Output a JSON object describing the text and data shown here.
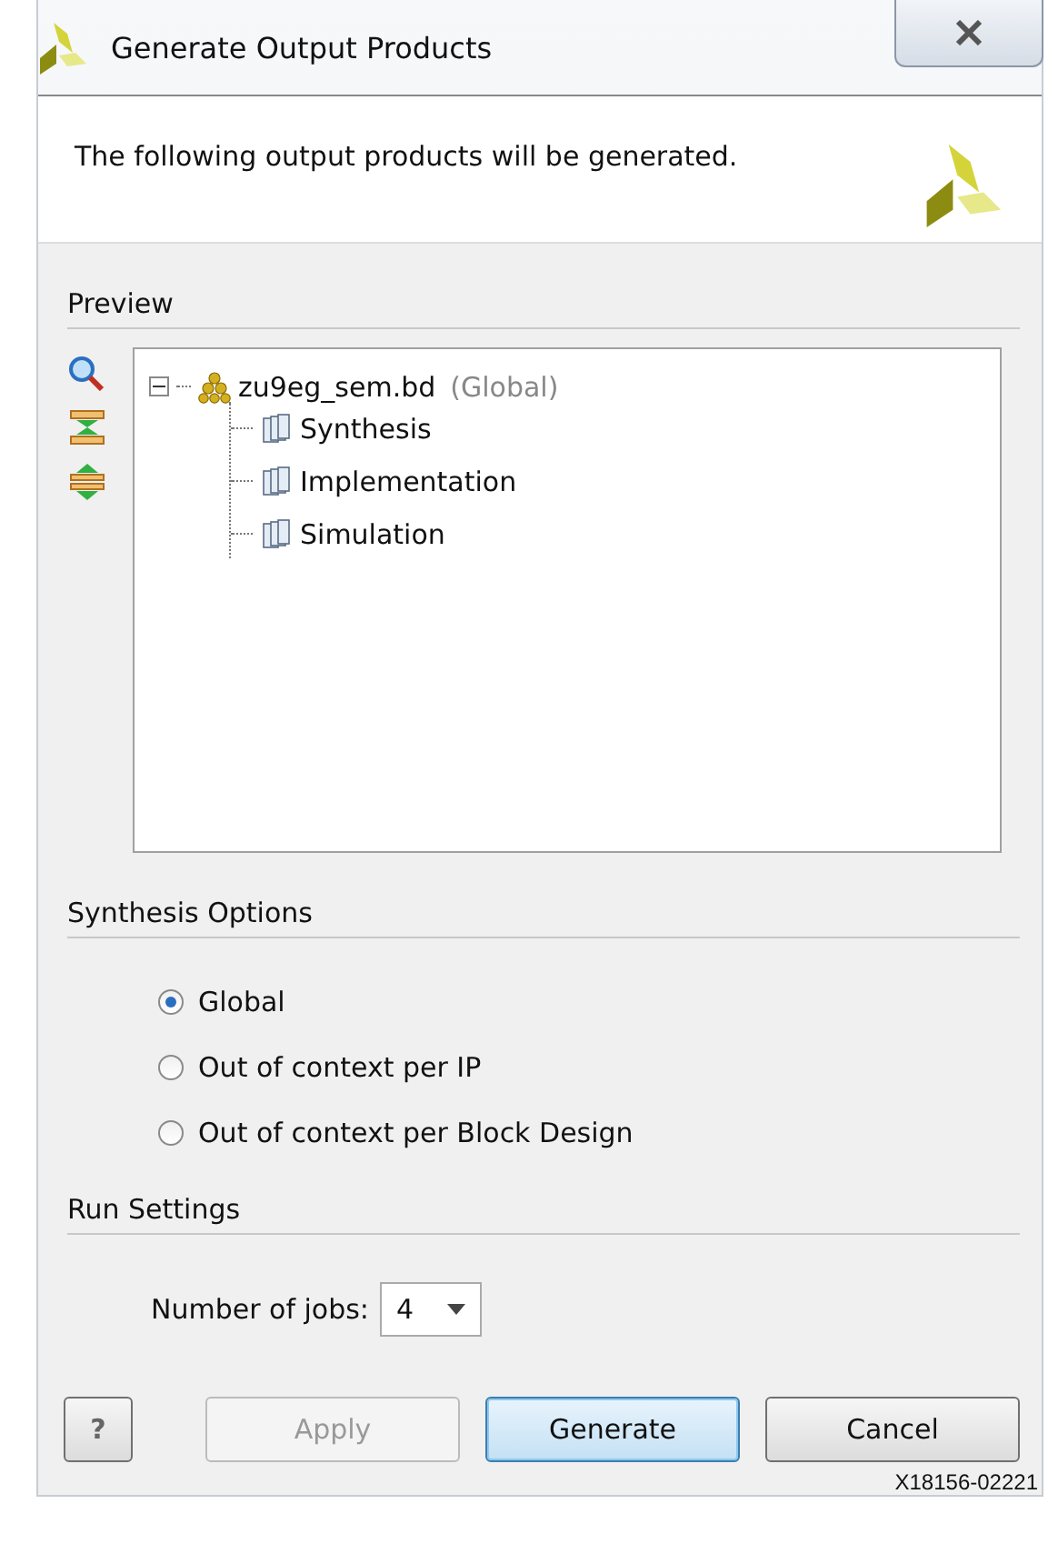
{
  "window": {
    "title": "Generate Output Products"
  },
  "header": {
    "message": "The following output products will be generated."
  },
  "preview": {
    "title": "Preview",
    "tree": [
      {
        "label": "zu9eg_sem.bd",
        "note": "(Global)",
        "kind": "design",
        "expanded": true,
        "children": [
          {
            "label": "Synthesis",
            "kind": "product"
          },
          {
            "label": "Implementation",
            "kind": "product"
          },
          {
            "label": "Simulation",
            "kind": "product"
          }
        ]
      }
    ]
  },
  "synthesis_options": {
    "title": "Synthesis Options",
    "options": [
      {
        "label": "Global",
        "selected": true
      },
      {
        "label": "Out of context per IP",
        "selected": false
      },
      {
        "label": "Out of context per Block Design",
        "selected": false
      }
    ]
  },
  "run_settings": {
    "title": "Run Settings",
    "jobs_label": "Number of jobs:",
    "jobs_value": "4"
  },
  "buttons": [
    {
      "label": "?",
      "kind": "help",
      "disabled": false
    },
    {
      "label": "Apply",
      "kind": "normal",
      "disabled": true
    },
    {
      "label": "Generate",
      "kind": "default",
      "disabled": false
    },
    {
      "label": "Cancel",
      "kind": "normal",
      "disabled": false
    }
  ],
  "figure_id": "X18156-02221"
}
